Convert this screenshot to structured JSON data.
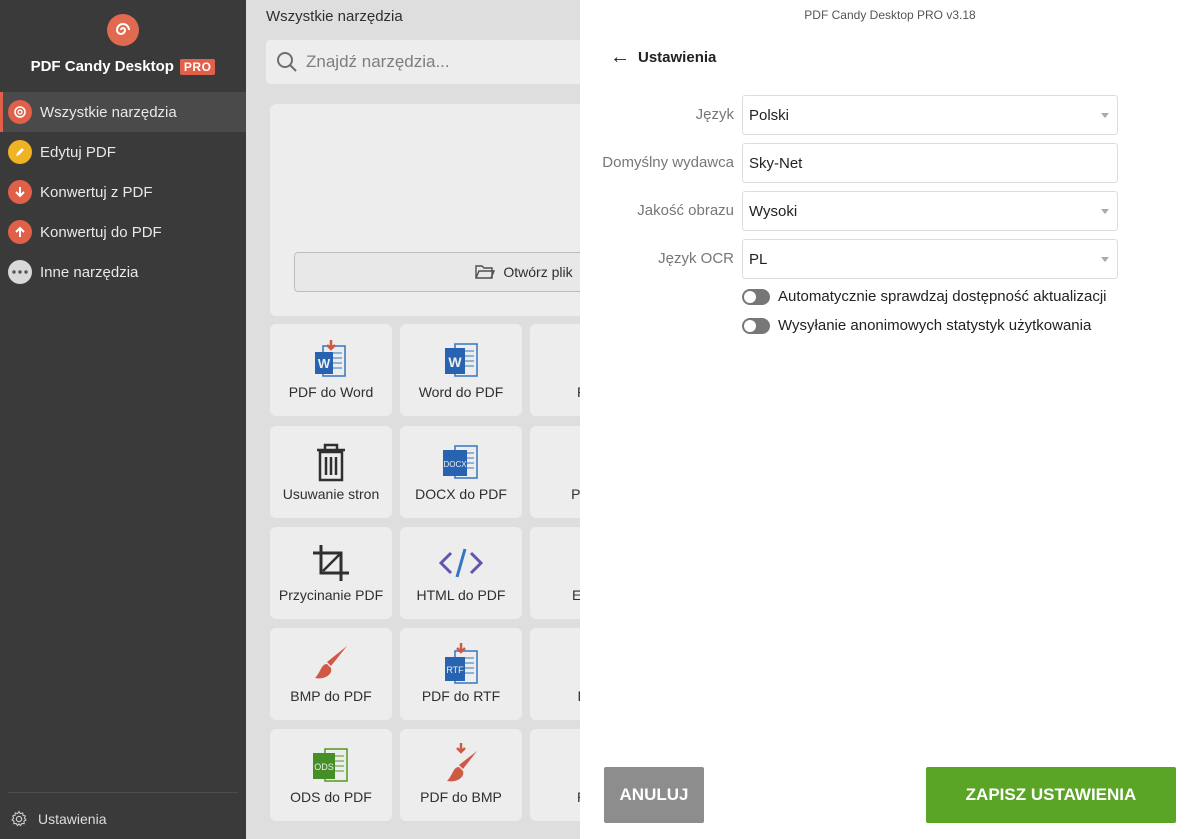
{
  "app": {
    "window_title": "PDF Candy Desktop PRO v3.18",
    "brand": "PDF Candy Desktop",
    "badge": "PRO"
  },
  "sidebar": {
    "items": [
      {
        "label": "Wszystkie narzędzia",
        "icon": "lollipop-icon",
        "color": "#e0604a",
        "active": true
      },
      {
        "label": "Edytuj PDF",
        "icon": "pencil-icon",
        "color": "#f0b323"
      },
      {
        "label": "Konwertuj z PDF",
        "icon": "arrow-down-icon",
        "color": "#e0604a"
      },
      {
        "label": "Konwertuj do PDF",
        "icon": "arrow-up-icon",
        "color": "#e0604a"
      },
      {
        "label": "Inne narzędzia",
        "icon": "more-dots-icon",
        "color": "#888888"
      }
    ],
    "settings_label": "Ustawienia"
  },
  "main": {
    "title": "Wszystkie narzędzia",
    "search_placeholder": "Znajdź narzędzia...",
    "open_file_label": "Otwórz plik",
    "tiles": [
      {
        "label": "PDF do Word",
        "icon": "pdf-to-word-icon"
      },
      {
        "label": "Word do PDF",
        "icon": "word-icon"
      },
      {
        "label": "PDF",
        "icon": "pdf-icon"
      },
      {
        "label": "Usuwanie stron",
        "icon": "trash-icon"
      },
      {
        "label": "DOCX do PDF",
        "icon": "docx-icon"
      },
      {
        "label": "PDF d",
        "icon": "pdf-icon"
      },
      {
        "label": "Przycinanie PDF",
        "icon": "crop-icon"
      },
      {
        "label": "HTML do PDF",
        "icon": "code-icon"
      },
      {
        "label": "EPUB",
        "icon": "epub-icon"
      },
      {
        "label": "BMP do PDF",
        "icon": "brush-icon"
      },
      {
        "label": "PDF do RTF",
        "icon": "rtf-icon"
      },
      {
        "label": "RTF",
        "icon": "rtf-icon"
      },
      {
        "label": "ODS do PDF",
        "icon": "ods-icon"
      },
      {
        "label": "PDF do BMP",
        "icon": "pdf-to-bmp-icon"
      },
      {
        "label": "PDF",
        "icon": "pdf-icon"
      }
    ]
  },
  "settings": {
    "heading": "Ustawienia",
    "fields": {
      "language": {
        "label": "Język",
        "value": "Polski"
      },
      "publisher": {
        "label": "Domyślny wydawca",
        "value": "Sky-Net"
      },
      "image_quality": {
        "label": "Jakość obrazu",
        "value": "Wysoki"
      },
      "ocr_language": {
        "label": "Język OCR",
        "value": "PL"
      }
    },
    "toggles": {
      "auto_update": {
        "label": "Automatycznie sprawdzaj dostępność aktualizacji",
        "on": false
      },
      "anon_stats": {
        "label": "Wysyłanie anonimowych statystyk użytkowania",
        "on": false
      }
    },
    "cancel_label": "ANULUJ",
    "save_label": "ZAPISZ USTAWIENIA"
  },
  "colors": {
    "accent": "#e0604a",
    "save_button": "#5aa525",
    "cancel_button": "#8d8d8d",
    "sidebar": "#3a3a3a"
  }
}
